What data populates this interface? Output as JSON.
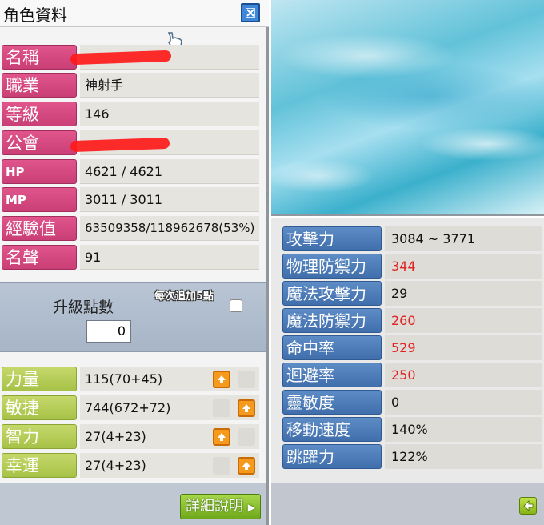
{
  "window": {
    "title": "角色資料"
  },
  "profile": [
    {
      "label": "名稱",
      "value": "",
      "redacted": true
    },
    {
      "label": "職業",
      "value": "神射手"
    },
    {
      "label": "等級",
      "value": "146"
    },
    {
      "label": "公會",
      "value": "",
      "redacted": true
    },
    {
      "label": "HP",
      "value": "4621 / 4621"
    },
    {
      "label": "MP",
      "value": "3011 / 3011"
    },
    {
      "label": "經驗值",
      "value": "63509358/118962678(53%)"
    },
    {
      "label": "名聲",
      "value": "91"
    }
  ],
  "ability_points": {
    "label": "升級點數",
    "value": "0",
    "mode_label": "每次追加5點"
  },
  "stats": [
    {
      "label": "力量",
      "value": "115(70+45)"
    },
    {
      "label": "敏捷",
      "value": "744(672+72)"
    },
    {
      "label": "智力",
      "value": "27(4+23)"
    },
    {
      "label": "幸運",
      "value": "27(4+23)"
    }
  ],
  "detail_button": {
    "label": "詳細說明"
  },
  "detail_stats": [
    {
      "label": "攻擊力",
      "value": "3084 ~ 3771",
      "highlight": false
    },
    {
      "label": "物理防禦力",
      "value": "344",
      "highlight": true
    },
    {
      "label": "魔法攻擊力",
      "value": "29",
      "highlight": false
    },
    {
      "label": "魔法防禦力",
      "value": "260",
      "highlight": true
    },
    {
      "label": "命中率",
      "value": "529",
      "highlight": true
    },
    {
      "label": "迴避率",
      "value": "250",
      "highlight": true
    },
    {
      "label": "靈敏度",
      "value": "0",
      "highlight": false
    },
    {
      "label": "移動速度",
      "value": "140%",
      "highlight": false
    },
    {
      "label": "跳躍力",
      "value": "122%",
      "highlight": false
    }
  ],
  "colors": {
    "profile_label": "#d44a80",
    "stat_label": "#b5cc56",
    "detail_label": "#4f7fbe",
    "highlight_value": "#e02222"
  },
  "icons": {
    "close": "close-icon",
    "up": "up-arrow-icon",
    "back": "back-arrow-icon",
    "cursor": "hand-cursor-icon"
  }
}
